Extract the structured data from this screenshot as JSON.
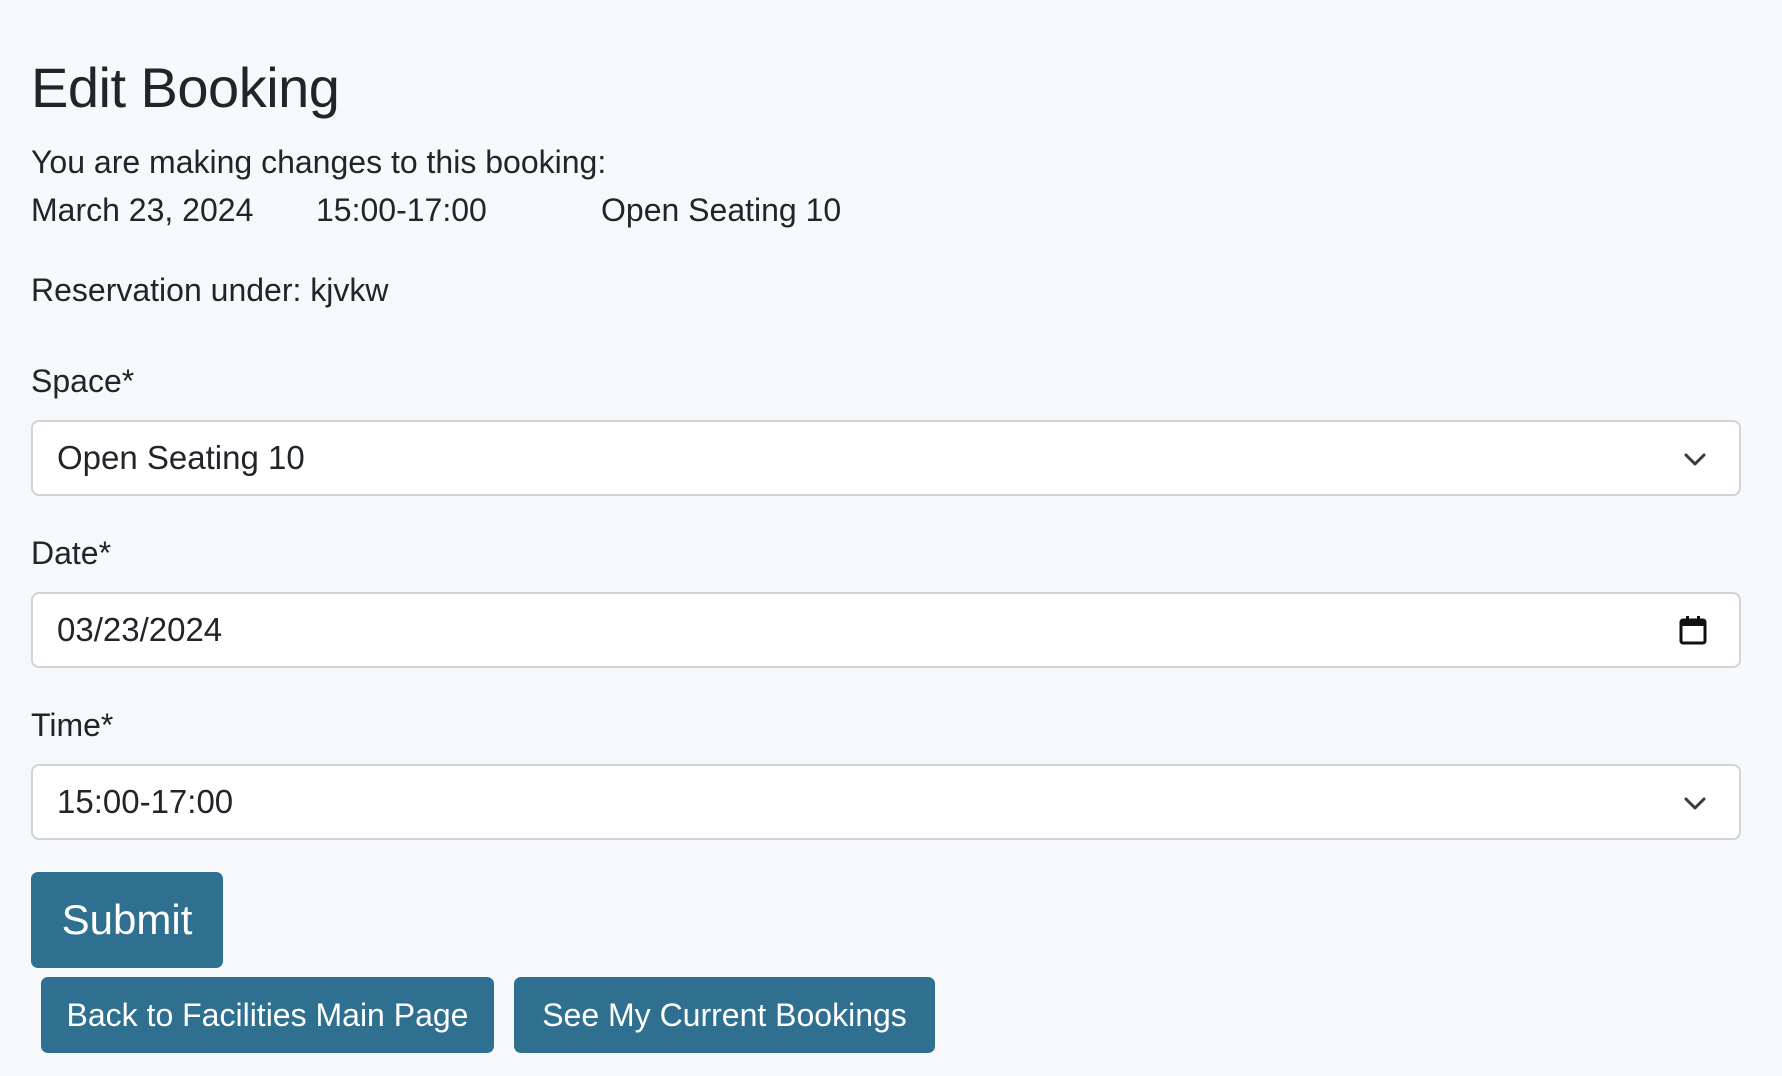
{
  "page": {
    "title": "Edit Booking",
    "intro": "You are making changes to this booking:",
    "summary": {
      "date": "March 23, 2024",
      "time": "15:00-17:00",
      "space": "Open Seating 10"
    },
    "reservation_label": "Reservation under: kjvkw"
  },
  "form": {
    "space": {
      "label": "Space*",
      "value": "Open Seating 10",
      "icon": "chevron-down-icon"
    },
    "date": {
      "label": "Date*",
      "value": "03/23/2024",
      "icon": "calendar-icon"
    },
    "time": {
      "label": "Time*",
      "value": "15:00-17:00",
      "icon": "chevron-down-icon"
    },
    "submit_label": "Submit"
  },
  "actions": {
    "back_label": "Back to Facilities Main Page",
    "bookings_label": "See My Current Bookings"
  },
  "colors": {
    "background": "#f7f8fa",
    "button": "#2f6f8f",
    "button_text": "#ffffff",
    "input_border": "#ced4da",
    "text": "#212529"
  }
}
